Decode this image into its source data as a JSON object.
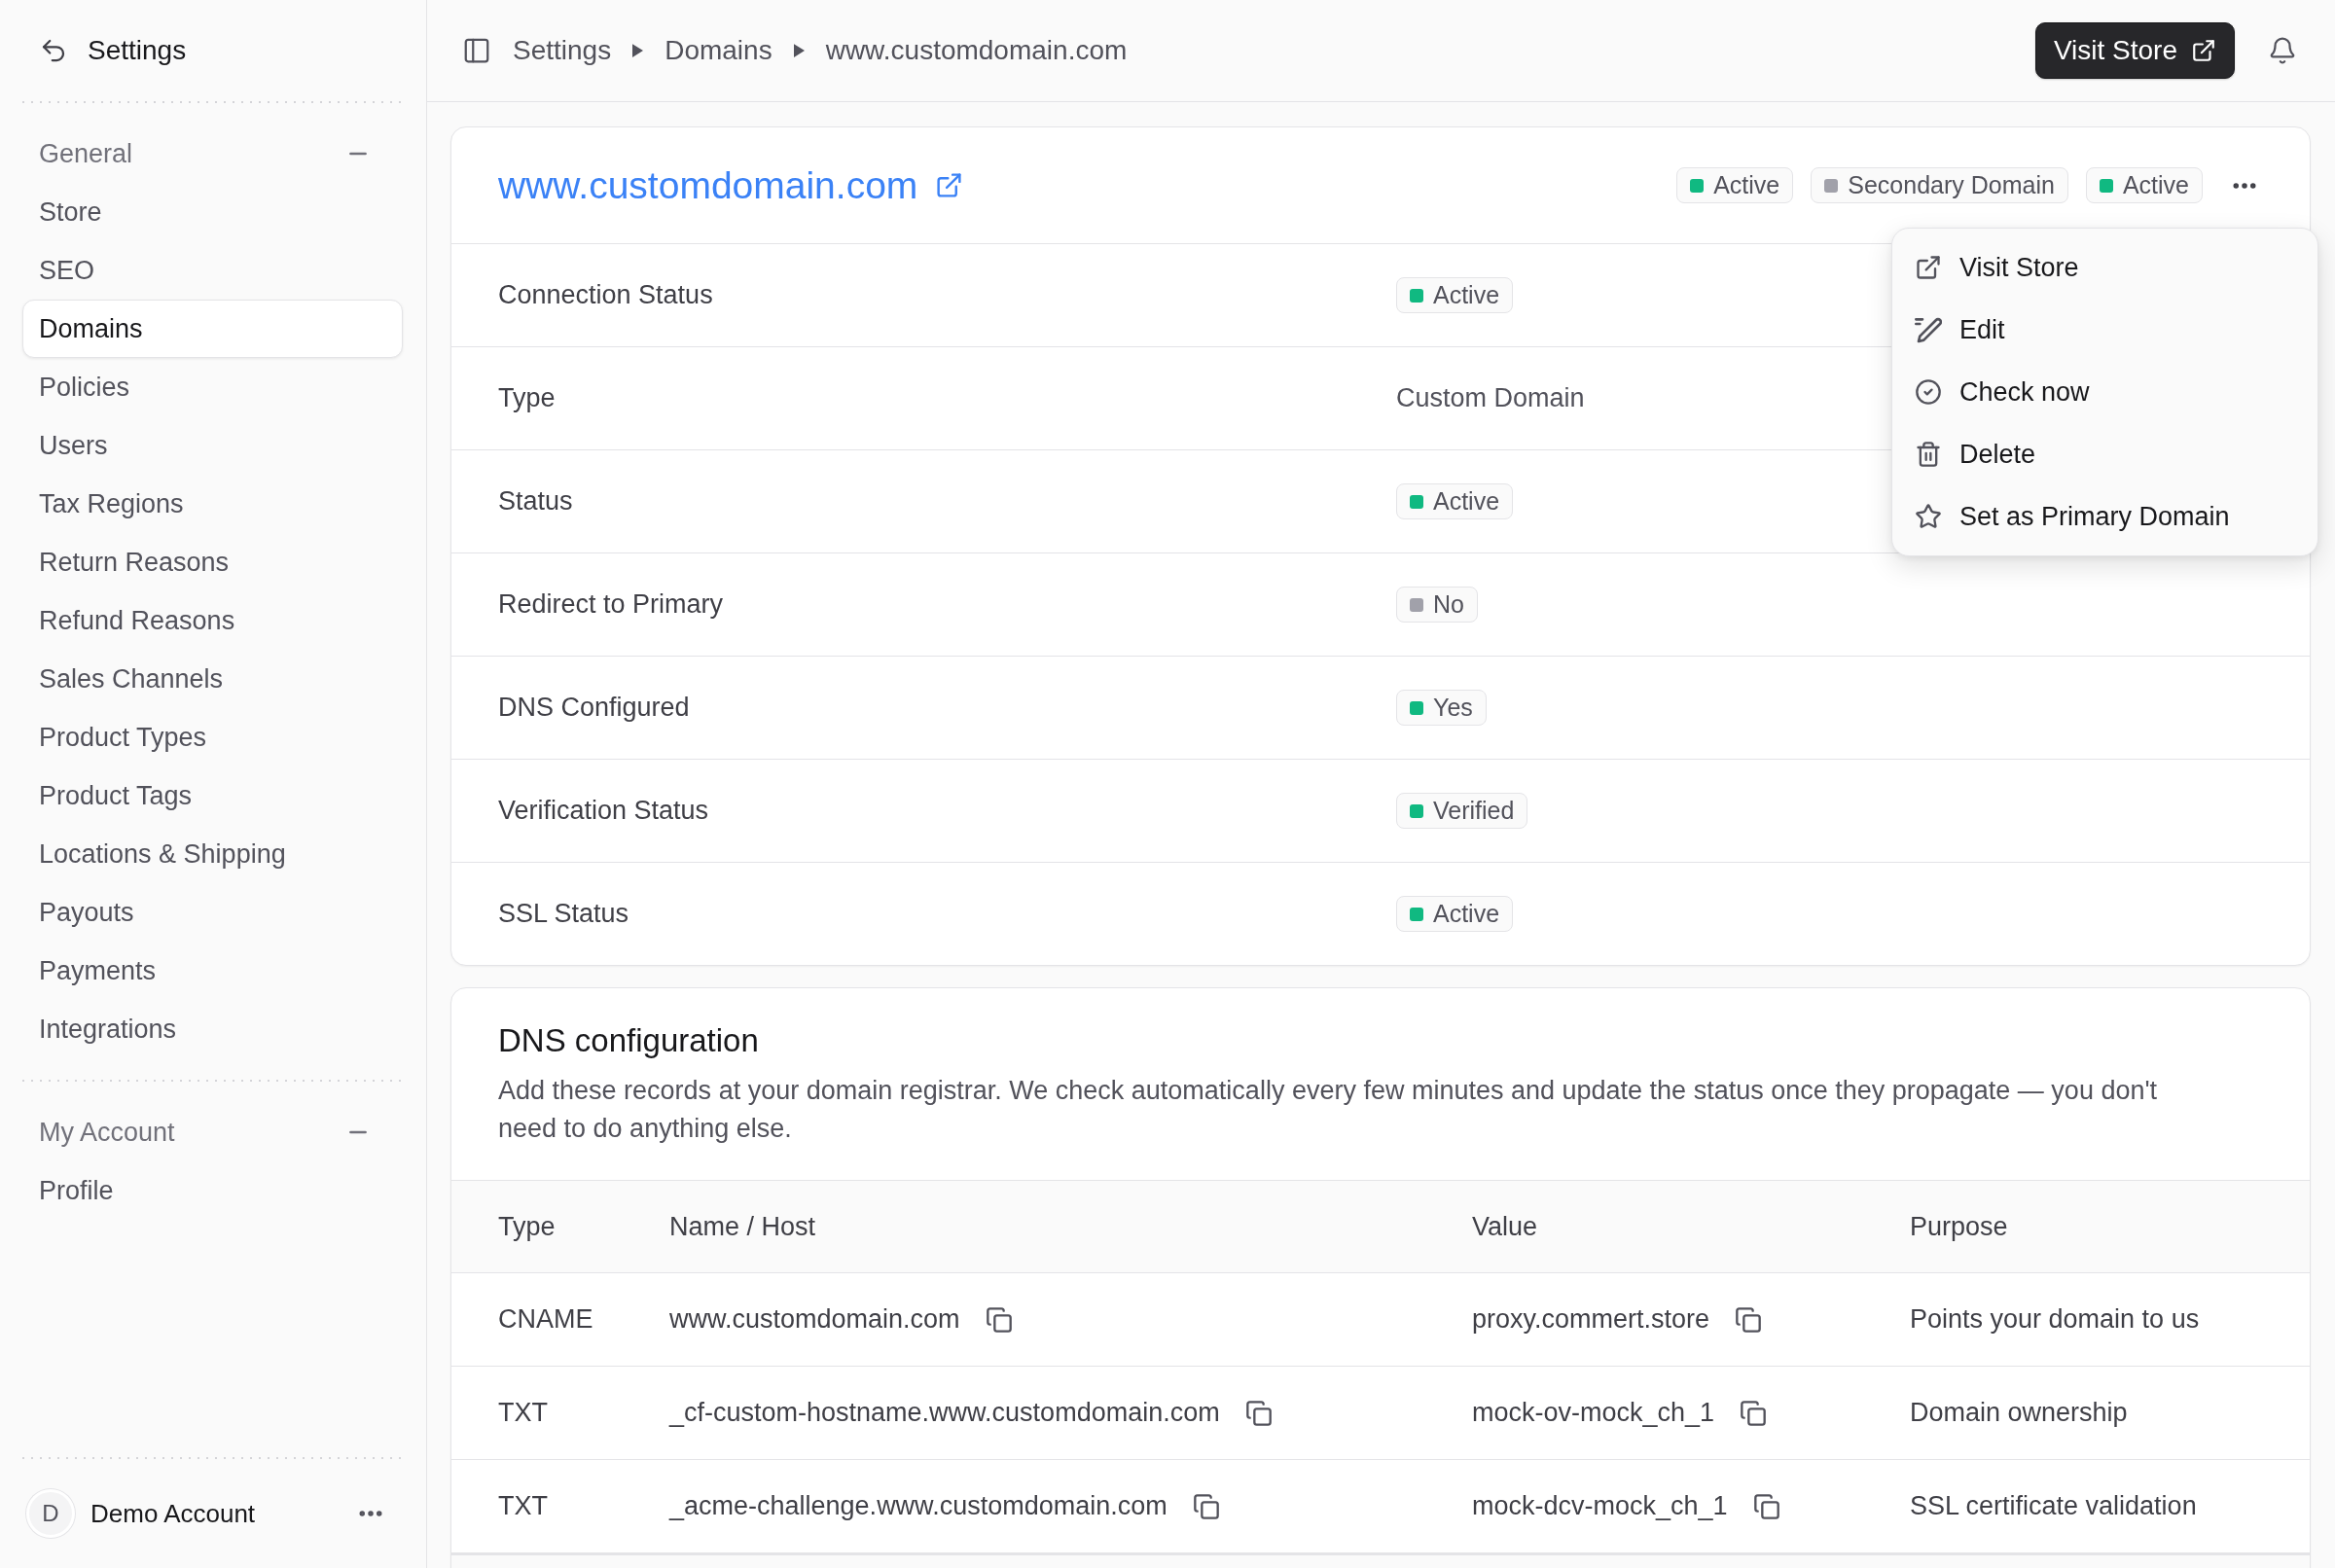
{
  "sidebar": {
    "title": "Settings",
    "groups": [
      {
        "title": "General",
        "expanded": true,
        "items": [
          {
            "label": "Store",
            "selected": false
          },
          {
            "label": "SEO",
            "selected": false
          },
          {
            "label": "Domains",
            "selected": true
          },
          {
            "label": "Policies",
            "selected": false
          },
          {
            "label": "Users",
            "selected": false
          },
          {
            "label": "Tax Regions",
            "selected": false
          },
          {
            "label": "Return Reasons",
            "selected": false
          },
          {
            "label": "Refund Reasons",
            "selected": false
          },
          {
            "label": "Sales Channels",
            "selected": false
          },
          {
            "label": "Product Types",
            "selected": false
          },
          {
            "label": "Product Tags",
            "selected": false
          },
          {
            "label": "Locations & Shipping",
            "selected": false
          },
          {
            "label": "Payouts",
            "selected": false
          },
          {
            "label": "Payments",
            "selected": false
          },
          {
            "label": "Integrations",
            "selected": false
          }
        ]
      },
      {
        "title": "My Account",
        "expanded": true,
        "items": [
          {
            "label": "Profile",
            "selected": false
          }
        ]
      }
    ],
    "account": {
      "initial": "D",
      "name": "Demo Account"
    }
  },
  "topbar": {
    "breadcrumbs": [
      "Settings",
      "Domains",
      "www.customdomain.com"
    ],
    "action_button": "Visit Store"
  },
  "domain_card": {
    "title": "www.customdomain.com",
    "badges": [
      {
        "label": "Active",
        "color": "#10b981"
      },
      {
        "label": "Secondary Domain",
        "color": "#a1a1aa"
      },
      {
        "label": "Active",
        "color": "#10b981"
      }
    ],
    "menu": {
      "items": [
        "Visit Store",
        "Edit",
        "Check now",
        "Delete",
        "Set as Primary Domain"
      ]
    },
    "rows": [
      {
        "label": "Connection Status",
        "kind": "badge",
        "value": "Active",
        "color": "#10b981"
      },
      {
        "label": "Type",
        "kind": "text",
        "value": "Custom Domain"
      },
      {
        "label": "Status",
        "kind": "badge",
        "value": "Active",
        "color": "#10b981"
      },
      {
        "label": "Redirect to Primary",
        "kind": "badge",
        "value": "No",
        "color": "#a1a1aa"
      },
      {
        "label": "DNS Configured",
        "kind": "badge",
        "value": "Yes",
        "color": "#10b981"
      },
      {
        "label": "Verification Status",
        "kind": "badge",
        "value": "Verified",
        "color": "#10b981"
      },
      {
        "label": "SSL Status",
        "kind": "badge",
        "value": "Active",
        "color": "#10b981"
      }
    ]
  },
  "dns": {
    "title": "DNS configuration",
    "description": "Add these records at your domain registrar. We check automatically every few minutes and update the status once they propagate — you don't need to do anything else.",
    "columns": [
      "Type",
      "Name / Host",
      "Value",
      "Purpose"
    ],
    "rows": [
      {
        "type": "CNAME",
        "host": "www.customdomain.com",
        "value": "proxy.commert.store",
        "purpose": "Points your domain to us"
      },
      {
        "type": "TXT",
        "host": "_cf-custom-hostname.www.customdomain.com",
        "value": "mock-ov-mock_ch_1",
        "purpose": "Domain ownership"
      },
      {
        "type": "TXT",
        "host": "_acme-challenge.www.customdomain.com",
        "value": "mock-dcv-mock_ch_1",
        "purpose": "SSL certificate validation"
      }
    ]
  }
}
